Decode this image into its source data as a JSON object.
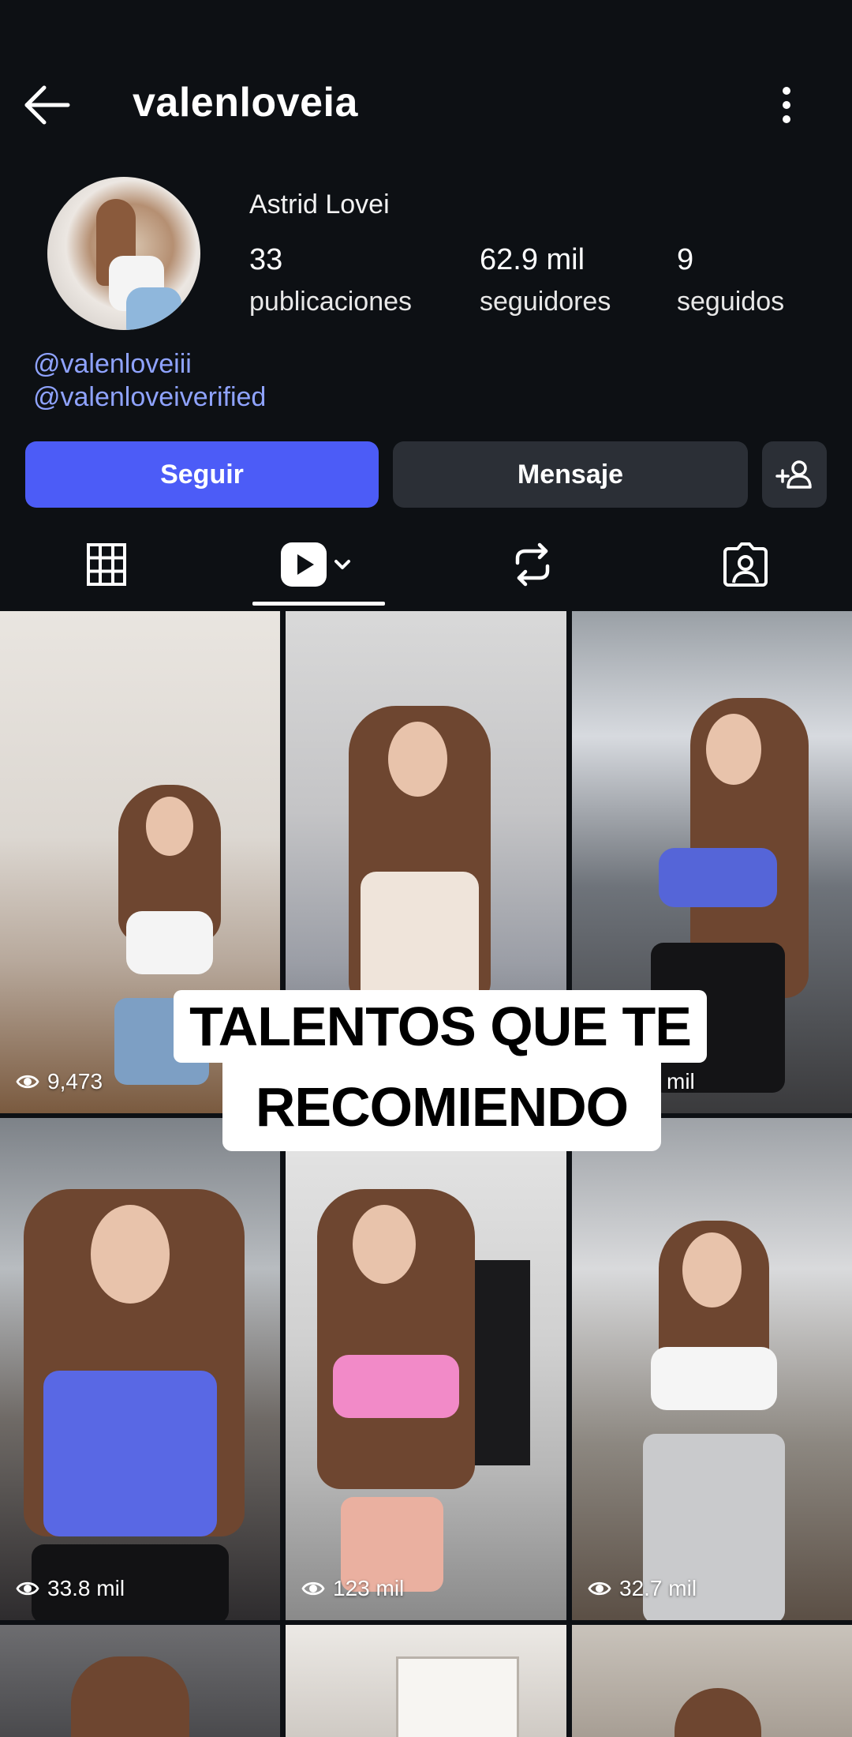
{
  "header": {
    "username": "valenloveia"
  },
  "profile": {
    "full_name": "Astrid Lovei",
    "stats": {
      "posts_count": "33",
      "posts_label": "publicaciones",
      "followers_count": "62.9 mil",
      "followers_label": "seguidores",
      "following_count": "9",
      "following_label": "seguidos"
    },
    "bio_links": [
      "@valenloveiii",
      "@valenloveiverified"
    ]
  },
  "actions": {
    "follow_label": "Seguir",
    "message_label": "Mensaje"
  },
  "tabs": [
    {
      "name": "grid",
      "icon": "grid-icon"
    },
    {
      "name": "reels",
      "icon": "reels-icon",
      "active": true
    },
    {
      "name": "reposts",
      "icon": "repost-icon"
    },
    {
      "name": "tagged",
      "icon": "tagged-icon"
    }
  ],
  "grid": {
    "items": [
      {
        "views": "9,473"
      },
      {
        "views": ""
      },
      {
        "views": "mil"
      },
      {
        "views": "33.8 mil"
      },
      {
        "views": "123 mil"
      },
      {
        "views": "32.7 mil"
      }
    ]
  },
  "overlay": {
    "line1": "TALENTOS QUE TE",
    "line2": "RECOMIENDO"
  },
  "colors": {
    "background": "#0d1014",
    "follow_button": "#4c5cf7",
    "secondary_button": "#2b2f36",
    "link": "#8fa3ff"
  }
}
